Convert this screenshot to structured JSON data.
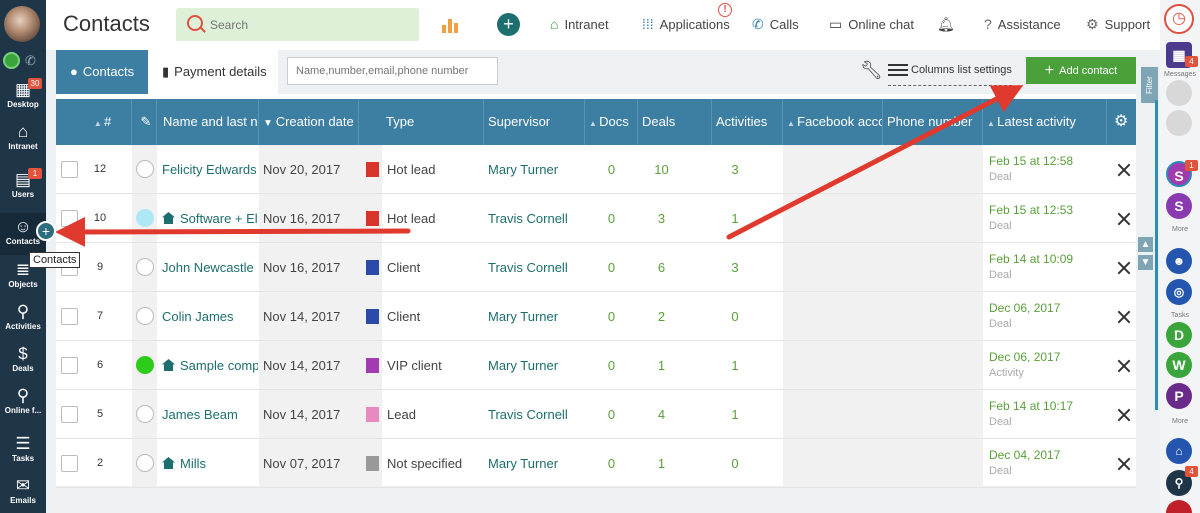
{
  "header": {
    "title": "Contacts",
    "search_placeholder": "Search",
    "nav": {
      "intranet": "Intranet",
      "applications": "Applications",
      "calls": "Calls",
      "online_chat": "Online chat",
      "assistance": "Assistance",
      "support": "Support"
    }
  },
  "left_nav": {
    "items": [
      {
        "label": "Desktop",
        "badge": "30"
      },
      {
        "label": "Intranet"
      },
      {
        "label": "Users",
        "badge": "1"
      },
      {
        "label": "Contacts"
      },
      {
        "label": "Objects"
      },
      {
        "label": "Activities"
      },
      {
        "label": "Deals"
      },
      {
        "label": "Online f..."
      },
      {
        "label": "Tasks"
      },
      {
        "label": "Emails"
      }
    ],
    "tooltip": "Contacts"
  },
  "toolbar": {
    "tab_contacts": "Contacts",
    "tab_payment": "Payment details",
    "filter_placeholder": "Name,number,email,phone number",
    "columns_settings": "Columns list settings",
    "add_contact": "Add contact"
  },
  "right_bar": {
    "messages_badge": "4",
    "messages_label": "Messages",
    "filter_label": "Filter",
    "s1_badge": "1",
    "s1_initial": "S",
    "s2_initial": "S",
    "more1": "More",
    "tasks_label": "Tasks",
    "d_initial": "D",
    "w_initial": "W",
    "p_initial": "P",
    "more2": "More",
    "bottom_badge": "4"
  },
  "table": {
    "columns": [
      "#",
      "Name and last na",
      "Creation date",
      "Type",
      "Supervisor",
      "Docs",
      "Deals",
      "Activities",
      "Facebook accou",
      "Phone number",
      "Latest activity"
    ],
    "rows": [
      {
        "num": "12",
        "name": "Felicity Edwards",
        "company": false,
        "status": "empty",
        "date": "Nov 20, 2017",
        "type": "Hot lead",
        "type_color": "#d9342b",
        "supervisor": "Mary Turner",
        "docs": "0",
        "deals": "10",
        "activities": "3",
        "activity_date": "Feb 15 at 12:58",
        "activity_type": "Deal"
      },
      {
        "num": "10",
        "name": "Software + Ele",
        "company": true,
        "status": "light",
        "date": "Nov 16, 2017",
        "type": "Hot lead",
        "type_color": "#d9342b",
        "supervisor": "Travis Cornell",
        "docs": "0",
        "deals": "3",
        "activities": "1",
        "activity_date": "Feb 15 at 12:53",
        "activity_type": "Deal"
      },
      {
        "num": "9",
        "name": "John Newcastle",
        "company": false,
        "status": "empty",
        "date": "Nov 16, 2017",
        "type": "Client",
        "type_color": "#2a4aa8",
        "supervisor": "Travis Cornell",
        "docs": "0",
        "deals": "6",
        "activities": "3",
        "activity_date": "Feb 14 at 10:09",
        "activity_type": "Deal"
      },
      {
        "num": "7",
        "name": "Colin James",
        "company": false,
        "status": "empty",
        "date": "Nov 14, 2017",
        "type": "Client",
        "type_color": "#2a4aa8",
        "supervisor": "Mary Turner",
        "docs": "0",
        "deals": "2",
        "activities": "0",
        "activity_date": "Dec 06, 2017",
        "activity_type": "Deal"
      },
      {
        "num": "6",
        "name": "Sample comp",
        "company": true,
        "status": "green",
        "date": "Nov 14, 2017",
        "type": "VIP client",
        "type_color": "#a23ab0",
        "supervisor": "Mary Turner",
        "docs": "0",
        "deals": "1",
        "activities": "1",
        "activity_date": "Dec 06, 2017",
        "activity_type": "Activity"
      },
      {
        "num": "5",
        "name": "James Beam",
        "company": false,
        "status": "empty",
        "date": "Nov 14, 2017",
        "type": "Lead",
        "type_color": "#e68ac0",
        "supervisor": "Travis Cornell",
        "docs": "0",
        "deals": "4",
        "activities": "1",
        "activity_date": "Feb 14 at 10:17",
        "activity_type": "Deal"
      },
      {
        "num": "2",
        "name": "Mills",
        "company": true,
        "status": "empty",
        "date": "Nov 07, 2017",
        "type": "Not specified",
        "type_color": "#999999",
        "supervisor": "Mary Turner",
        "docs": "0",
        "deals": "1",
        "activities": "0",
        "activity_date": "Dec 04, 2017",
        "activity_type": "Deal"
      }
    ]
  },
  "colors": {
    "accent": "#3d7ea3",
    "sidebar": "#1f3548",
    "add_button": "#4aa13a",
    "arrow": "#e03a2e"
  }
}
